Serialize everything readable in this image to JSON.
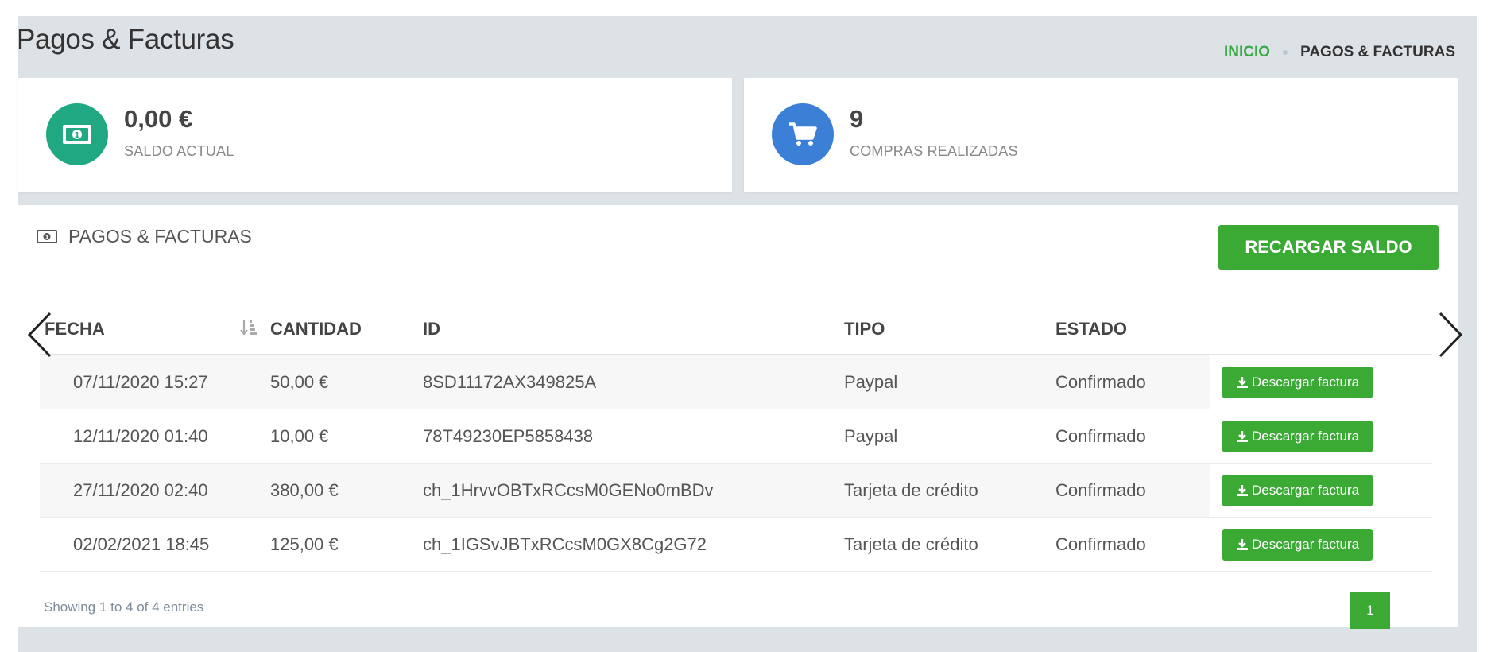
{
  "header": {
    "title": "Pagos & Facturas",
    "breadcrumb": {
      "home": "INICIO",
      "current": "PAGOS & FACTURAS"
    }
  },
  "stats": [
    {
      "value": "0,00 €",
      "label": "SALDO ACTUAL",
      "icon": "money-icon",
      "color": "#1fa882"
    },
    {
      "value": "9",
      "label": "COMPRAS REALIZADAS",
      "icon": "cart-icon",
      "color": "#3b80d6"
    }
  ],
  "panel": {
    "title": "PAGOS & FACTURAS",
    "recharge_button": "RECARGAR SALDO",
    "columns": [
      "FECHA",
      "CANTIDAD",
      "ID",
      "TIPO",
      "ESTADO"
    ],
    "rows": [
      {
        "fecha": "07/11/2020 15:27",
        "cantidad": "50,00 €",
        "id": "8SD11172AX349825A",
        "tipo": "Paypal",
        "estado": "Confirmado",
        "action": "Descargar factura"
      },
      {
        "fecha": "12/11/2020 01:40",
        "cantidad": "10,00 €",
        "id": "78T49230EP5858438",
        "tipo": "Paypal",
        "estado": "Confirmado",
        "action": "Descargar factura"
      },
      {
        "fecha": "27/11/2020 02:40",
        "cantidad": "380,00 €",
        "id": "ch_1HrvvOBTxRCcsM0GENo0mBDv",
        "tipo": "Tarjeta de crédito",
        "estado": "Confirmado",
        "action": "Descargar factura"
      },
      {
        "fecha": "02/02/2021 18:45",
        "cantidad": "125,00 €",
        "id": "ch_1IGSvJBTxRCcsM0GX8Cg2G72",
        "tipo": "Tarjeta de crédito",
        "estado": "Confirmado",
        "action": "Descargar factura"
      }
    ],
    "info": "Showing 1 to 4 of 4 entries",
    "page": "1"
  },
  "colors": {
    "accent": "#3aaa35",
    "teal": "#1fa882",
    "blue": "#3b80d6"
  }
}
